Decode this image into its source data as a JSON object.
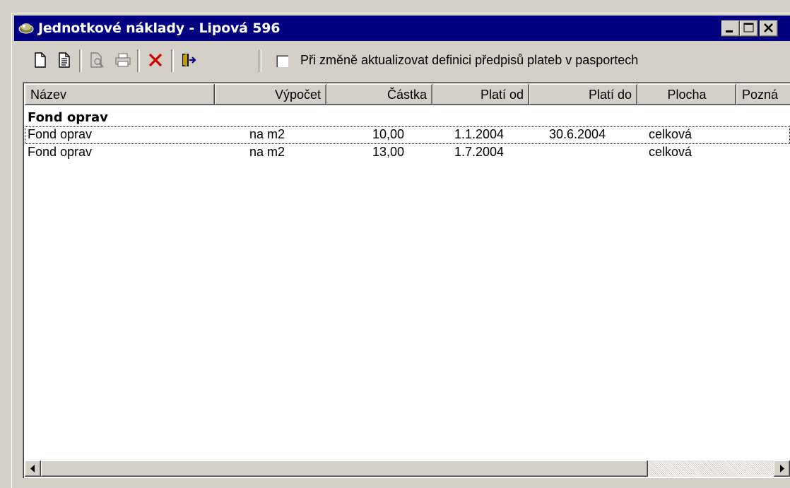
{
  "window": {
    "title": "Jednotkové náklady - Lipová 596"
  },
  "toolbar": {
    "checkbox_label": "Při změně aktualizovat definici předpisů plateb v pasportech",
    "checkbox_checked": false
  },
  "list": {
    "columns": [
      "Název",
      "Výpočet",
      "Částka",
      "Platí od",
      "Platí do",
      "Plocha",
      "Pozná"
    ],
    "group": "Fond oprav",
    "rows": [
      {
        "nazev": "Fond oprav",
        "vypocet": "na m2",
        "castka": "10,00",
        "plati_od": "1.1.2004",
        "plati_do": "30.6.2004",
        "plocha": "celková"
      },
      {
        "nazev": "Fond oprav",
        "vypocet": "na m2",
        "castka": "13,00",
        "plati_od": "1.7.2004",
        "plati_do": "",
        "plocha": "celková"
      }
    ]
  },
  "colors": {
    "titlebar": "#000080",
    "face": "#d4d0c8",
    "delete_icon": "#cc0000"
  }
}
